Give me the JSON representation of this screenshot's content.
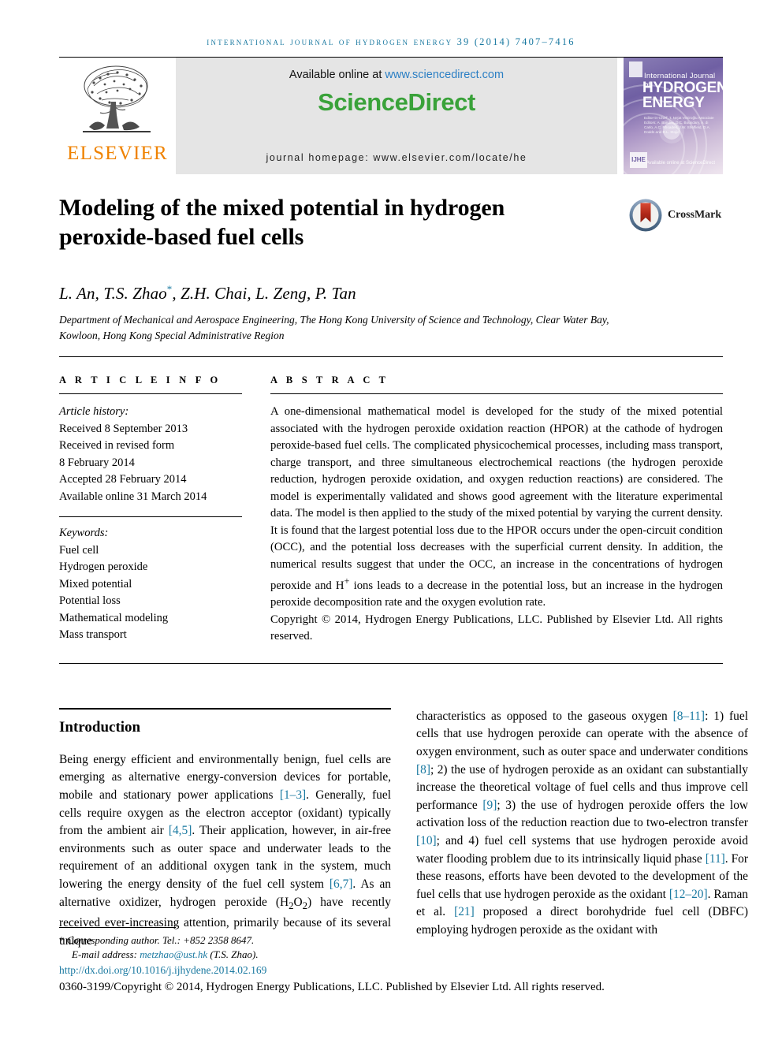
{
  "running_head": "International Journal of Hydrogen Energy 39 (2014) 7407–7416",
  "masthead": {
    "publisher_name": "ELSEVIER",
    "available_online_prefix": "Available online at ",
    "sciencedirect_url": "www.sciencedirect.com",
    "sciencedirect_logo": "ScienceDirect",
    "journal_homepage": "journal homepage: www.elsevier.com/locate/he",
    "cover": {
      "small_title": "International Journal of",
      "big_title_line1": "HYDROGEN",
      "big_title_line2": "ENERGY",
      "editors": "Editor-in-Chief: T. Nejat Veziroğlu\nAssociate Editors: A. Bandini, D.C. Boundary, A. di Carlo, A.C. Rhoades, J.W. Sheffield, D.A. Dodds and D.L. Stojic",
      "badge": "IJHE",
      "sciencedirect_mark": "Available online at\nScienceDirect"
    }
  },
  "article": {
    "title": "Modeling of the mixed potential in hydrogen peroxide-based fuel cells",
    "crossmark_label": "CrossMark",
    "authors_parts": [
      {
        "text": "L. An, T.S. Zhao",
        "sup": ""
      },
      {
        "text": "*",
        "sup": "true"
      },
      {
        "text": ", Z.H. Chai, L. Zeng, P. Tan",
        "sup": ""
      }
    ],
    "authors_plain": "L. An, T.S. Zhao*, Z.H. Chai, L. Zeng, P. Tan",
    "affiliation": "Department of Mechanical and Aerospace Engineering, The Hong Kong University of Science and Technology, Clear Water Bay, Kowloon, Hong Kong Special Administrative Region"
  },
  "article_info": {
    "section_label": "A R T I C L E   I N F O",
    "history_label": "Article history:",
    "history": [
      "Received 8 September 2013",
      "Received in revised form",
      "8 February 2014",
      "Accepted 28 February 2014",
      "Available online 31 March 2014"
    ],
    "keywords_label": "Keywords:",
    "keywords": [
      "Fuel cell",
      "Hydrogen peroxide",
      "Mixed potential",
      "Potential loss",
      "Mathematical modeling",
      "Mass transport"
    ]
  },
  "abstract": {
    "section_label": "A B S T R A C T",
    "text": "A one-dimensional mathematical model is developed for the study of the mixed potential associated with the hydrogen peroxide oxidation reaction (HPOR) at the cathode of hydrogen peroxide-based fuel cells. The complicated physicochemical processes, including mass transport, charge transport, and three simultaneous electrochemical reactions (the hydrogen peroxide reduction, hydrogen peroxide oxidation, and oxygen reduction reactions) are considered. The model is experimentally validated and shows good agreement with the literature experimental data. The model is then applied to the study of the mixed potential by varying the current density. It is found that the largest potential loss due to the HPOR occurs under the open-circuit condition (OCC), and the potential loss decreases with the superficial current density. In addition, the numerical results suggest that under the OCC, an increase in the concentrations of hydrogen peroxide and H+ ions leads to a decrease in the potential loss, but an increase in the hydrogen peroxide decomposition rate and the oxygen evolution rate.",
    "copyright": "Copyright © 2014, Hydrogen Energy Publications, LLC. Published by Elsevier Ltd. All rights reserved."
  },
  "introduction": {
    "title": "Introduction",
    "left_column": "Being energy efficient and environmentally benign, fuel cells are emerging as alternative energy-conversion devices for portable, mobile and stationary power applications [1–3]. Generally, fuel cells require oxygen as the electron acceptor (oxidant) typically from the ambient air [4,5]. Their application, however, in air-free environments such as outer space and underwater leads to the requirement of an additional oxygen tank in the system, much lowering the energy density of the fuel cell system [6,7]. As an alternative oxidizer, hydrogen peroxide (H2O2) have recently received ever-increasing attention, primarily because of its several unique",
    "right_column": "characteristics as opposed to the gaseous oxygen [8–11]: 1) fuel cells that use hydrogen peroxide can operate with the absence of oxygen environment, such as outer space and underwater conditions [8]; 2) the use of hydrogen peroxide as an oxidant can substantially increase the theoretical voltage of fuel cells and thus improve cell performance [9]; 3) the use of hydrogen peroxide offers the low activation loss of the reduction reaction due to two-electron transfer [10]; and 4) fuel cell systems that use hydrogen peroxide avoid water flooding problem due to its intrinsically liquid phase [11]. For these reasons, efforts have been devoted to the development of the fuel cells that use hydrogen peroxide as the oxidant [12–20]. Raman et al. [21] proposed a direct borohydride fuel cell (DBFC) employing hydrogen peroxide as the oxidant with"
  },
  "footer": {
    "corresponding_author": "Corresponding author. Tel.: +852 2358 8647.",
    "email_label": "E-mail address: ",
    "email": "metzhao@ust.hk",
    "email_suffix": " (T.S. Zhao).",
    "doi": "http://dx.doi.org/10.1016/j.ijhydene.2014.02.169",
    "issn_copyright": "0360-3199/Copyright © 2014, Hydrogen Energy Publications, LLC. Published by Elsevier Ltd. All rights reserved."
  },
  "colors": {
    "link": "#1878a0",
    "elsevier_orange": "#ef8200",
    "sciencedirect_green": "#3aa23a",
    "sciencedirect_blue": "#2b7fc4"
  }
}
